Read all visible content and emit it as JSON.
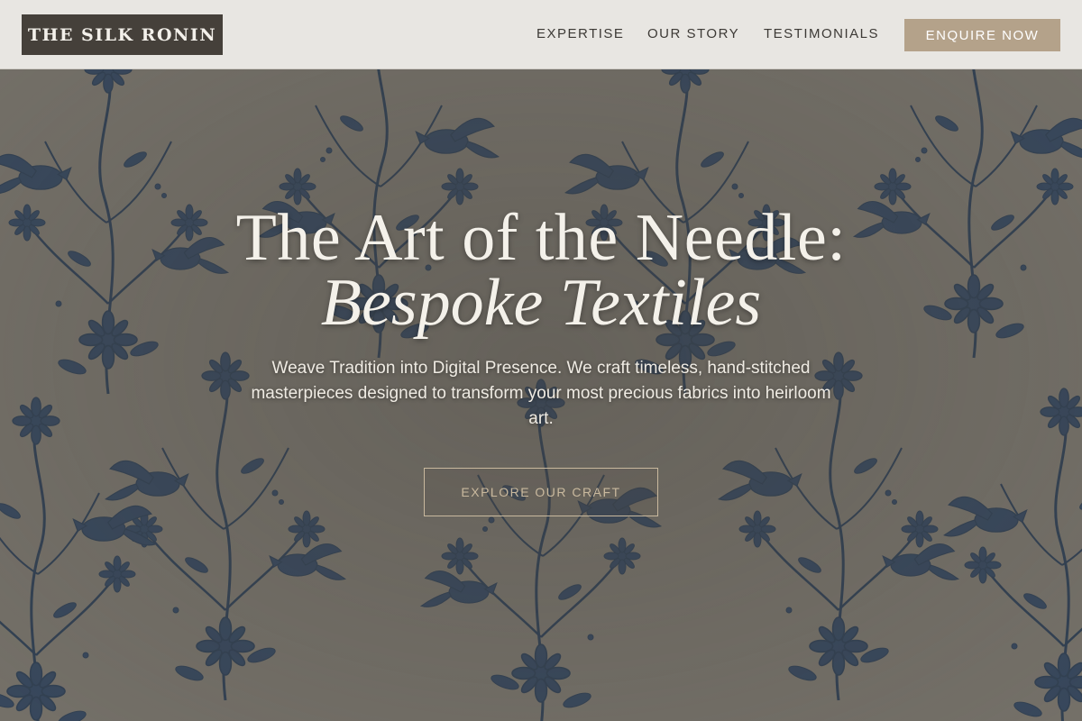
{
  "brand": {
    "name": "THE SILK RONIN"
  },
  "nav": {
    "items": [
      {
        "label": "EXPERTISE"
      },
      {
        "label": "OUR STORY"
      },
      {
        "label": "TESTIMONIALS"
      }
    ],
    "cta_label": "ENQUIRE NOW"
  },
  "hero": {
    "headline_line1": "The Art of the Needle:",
    "headline_line2": "Bespoke Textiles",
    "subtitle": "Weave Tradition into Digital Presence. We craft timeless, hand-stitched masterpieces designed to transform your most precious fabrics into heirloom art.",
    "button_label": "EXPLORE OUR CRAFT",
    "background": "embroidered-floral-bird-pattern"
  },
  "colors": {
    "header_bg": "#e8e6e2",
    "logo_bg": "#45403a",
    "accent": "#b4a28a",
    "hero_bg": "#75716a",
    "pattern_ink": "#243852"
  }
}
